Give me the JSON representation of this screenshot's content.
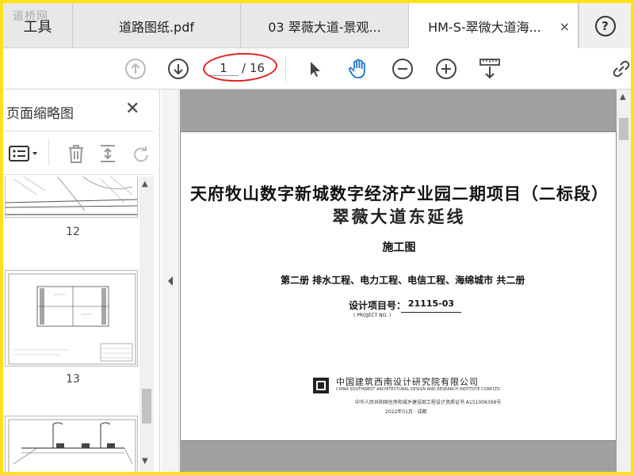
{
  "watermark": "道桥网",
  "tabs": {
    "tools_label": "工具",
    "items": [
      {
        "label": "道路图纸.pdf"
      },
      {
        "label": "03 翠薇大道-景观..."
      },
      {
        "label": "HM-S-翠微大道海..."
      }
    ],
    "close_glyph": "×",
    "help_glyph": "?"
  },
  "toolbar": {
    "current_page": "1",
    "total_pages": "/ 16"
  },
  "left_panel": {
    "title": "页面缩略图",
    "close_glyph": "✕",
    "thumbnails": [
      {
        "label": "12"
      },
      {
        "label": "13"
      }
    ]
  },
  "document": {
    "title_line1": "天府牧山数字新城数字经济产业园二期项目（二标段）",
    "title_line2": "翠薇大道东延线",
    "subtitle": "施工图",
    "volume_line": "第二册    排水工程、电力工程、电信工程、海绵城市     共二册",
    "project_label": "设计项目号：",
    "project_no": "21115-03",
    "project_label_en": "( PROJECT NO. )",
    "company_name": "中国建筑西南设计研究院有限公司",
    "company_en": "CHINA SOUTHWEST ARCHITECTURAL DESIGN AND RESEARCH INSTITUTE CORP.LTD",
    "certificate": "中华人民共和国住房和城乡建设部工程设计资质证书 A151006399号",
    "date": "2022年01月  ·  成都"
  },
  "colors": {
    "highlight_oval": "#e02020",
    "accent_blue": "#1a73c8",
    "frame_border": "#ffe21a"
  }
}
